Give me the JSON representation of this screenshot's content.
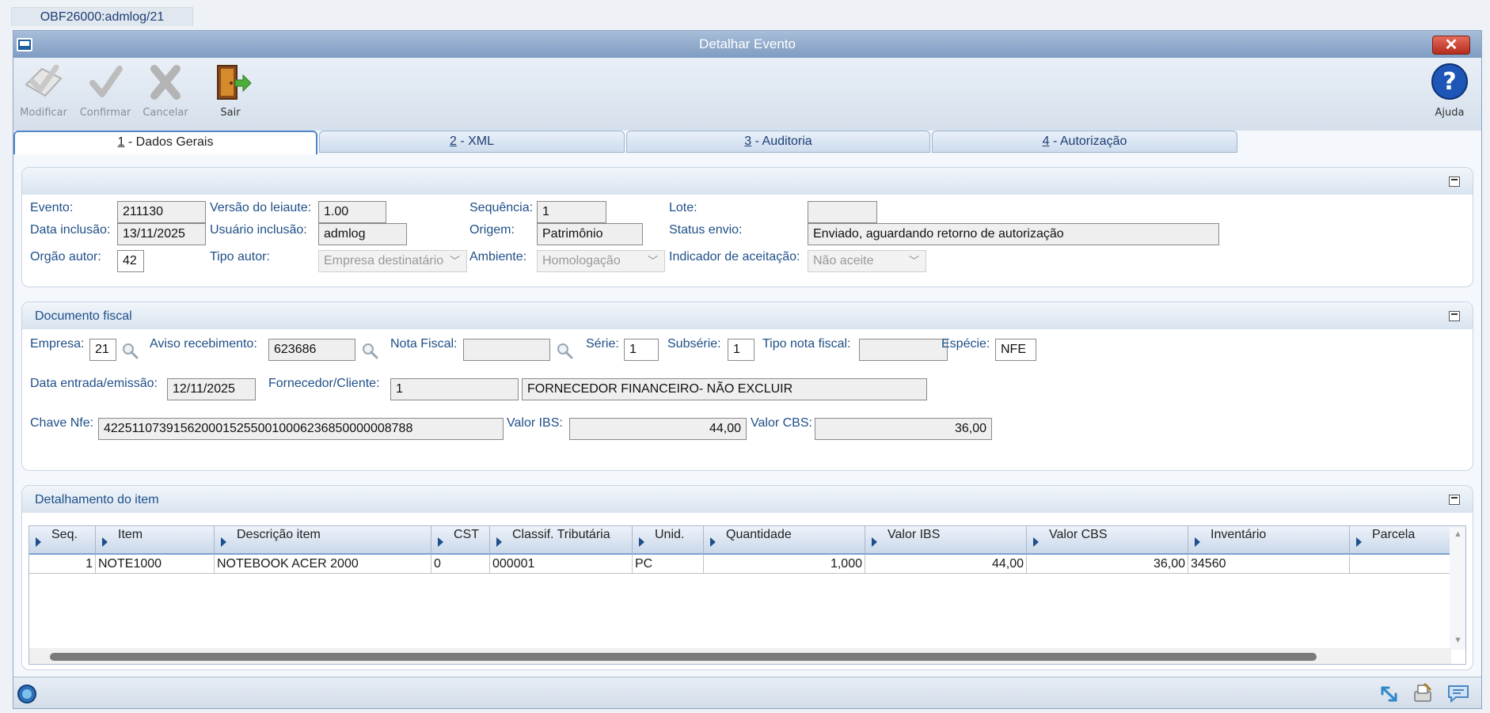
{
  "doc_tab": "OBF26000:admlog/21",
  "window": {
    "title": "Detalhar Evento",
    "close_label": "✕"
  },
  "toolbar": {
    "modify": "Modificar",
    "confirm": "Confirmar",
    "cancel": "Cancelar",
    "exit": "Sair",
    "help": "Ajuda"
  },
  "tabs": [
    {
      "num": "1",
      "label": " - Dados Gerais"
    },
    {
      "num": "2",
      "label": " - XML"
    },
    {
      "num": "3",
      "label": " - Auditoria"
    },
    {
      "num": "4",
      "label": " - Autorização"
    }
  ],
  "general": {
    "evento_label": "Evento:",
    "evento": "211130",
    "versao_label": "Versão do leiaute:",
    "versao": "1.00",
    "sequencia_label": "Sequência:",
    "sequencia": "1",
    "lote_label": "Lote:",
    "lote": "",
    "data_inclusao_label": "Data inclusão:",
    "data_inclusao": "13/11/2025",
    "usuario_label": "Usuário inclusão:",
    "usuario": "admlog",
    "origem_label": "Origem:",
    "origem": "Patrimônio",
    "status_label": "Status envio:",
    "status": "Enviado, aguardando retorno de autorização",
    "orgao_label": "Orgão autor:",
    "orgao": "42",
    "tipo_autor_label": "Tipo autor:",
    "tipo_autor": "Empresa destinatário",
    "ambiente_label": "Ambiente:",
    "ambiente": "Homologação",
    "indicador_label": "Indicador de aceitação:",
    "indicador": "Não aceite"
  },
  "fiscal": {
    "title": "Documento fiscal",
    "empresa_label": "Empresa:",
    "empresa": "21",
    "aviso_label": "Aviso recebimento:",
    "aviso": "623686",
    "nota_label": "Nota Fiscal:",
    "nota": "",
    "serie_label": "Série:",
    "serie": "1",
    "subserie_label": "Subsérie:",
    "subserie": "1",
    "tipo_nota_label": "Tipo nota fiscal:",
    "tipo_nota": "",
    "especie_label": "Espécie:",
    "especie": "NFE",
    "data_entrada_label": "Data entrada/emissão:",
    "data_entrada": "12/11/2025",
    "fornecedor_label": "Fornecedor/Cliente:",
    "fornecedor_code": "1",
    "fornecedor_name": "FORNECEDOR FINANCEIRO- NÃO EXCLUIR",
    "chave_label": "Chave Nfe:",
    "chave": "42251107391562000152550010006236850000008788",
    "valor_ibs_label": "Valor IBS:",
    "valor_ibs": "44,00",
    "valor_cbs_label": "Valor CBS:",
    "valor_cbs": "36,00"
  },
  "items": {
    "title": "Detalhamento do item",
    "columns": [
      "Seq.",
      "Item",
      "Descrição item",
      "CST",
      "Classif. Tributária",
      "Unid.",
      "Quantidade",
      "Valor IBS",
      "Valor CBS",
      "Inventário",
      "Parcela"
    ],
    "rows": [
      [
        "1",
        "NOTE1000",
        "NOTEBOOK ACER 2000",
        "0",
        "000001",
        "PC",
        "1,000",
        "44,00",
        "36,00",
        "34560",
        ""
      ]
    ]
  }
}
